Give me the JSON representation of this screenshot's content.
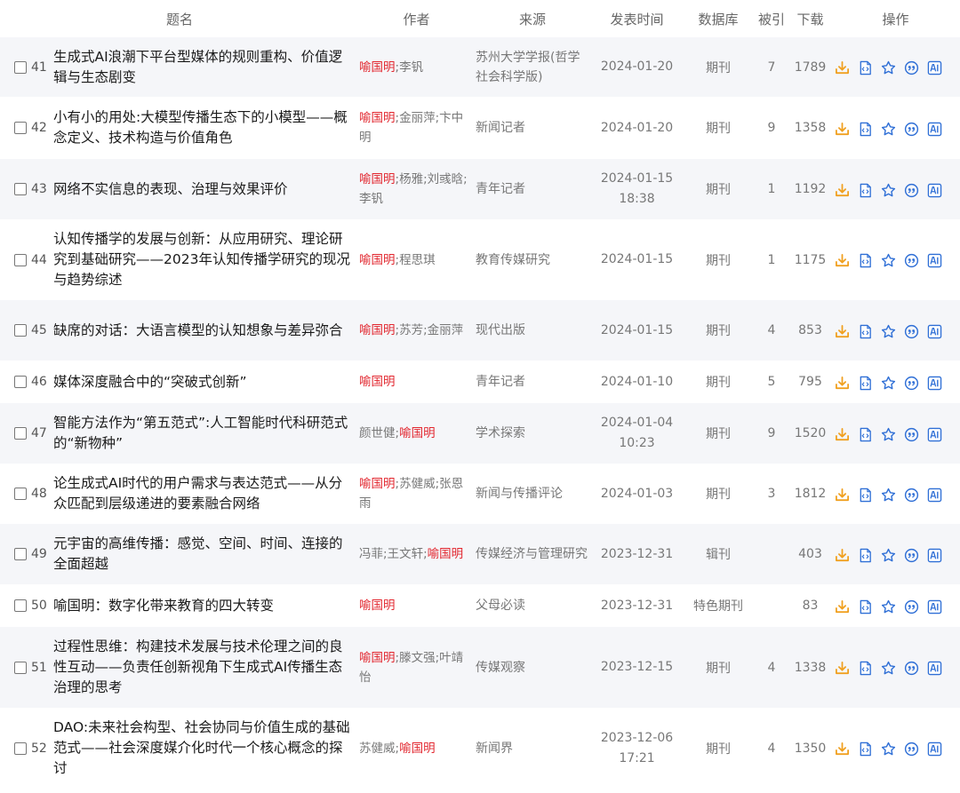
{
  "headers": {
    "title": "题名",
    "author": "作者",
    "source": "来源",
    "date": "发表时间",
    "db": "数据库",
    "cited": "被引",
    "downloads": "下载",
    "ops": "操作"
  },
  "colors": {
    "accent": "#e2262e",
    "download_icon": "#f0a020",
    "icon_blue": "#2f6fd6"
  },
  "operations": [
    "download-icon",
    "html-read-icon",
    "favorite-star-icon",
    "cite-quote-icon",
    "ai-assistant-icon"
  ],
  "rows": [
    {
      "num": "41",
      "title": "生成式AI浪潮下平台型媒体的规则重构、价值逻辑与生态剧变",
      "authors": [
        {
          "name": "喻国明",
          "hl": true
        },
        {
          "name": "李钒",
          "hl": false
        }
      ],
      "source": "苏州大学学报(哲学社会科学版)",
      "date": "2024-01-20",
      "time": "",
      "db": "期刊",
      "cited": "7",
      "downloads": "1789"
    },
    {
      "num": "42",
      "title": "小有小的用处:大模型传播生态下的小模型——概念定义、技术构造与价值角色",
      "authors": [
        {
          "name": "喻国明",
          "hl": true
        },
        {
          "name": "金丽萍",
          "hl": false
        },
        {
          "name": "卞中明",
          "hl": false
        }
      ],
      "source": "新闻记者",
      "date": "2024-01-20",
      "time": "",
      "db": "期刊",
      "cited": "9",
      "downloads": "1358"
    },
    {
      "num": "43",
      "title": "网络不实信息的表现、治理与效果评价",
      "authors": [
        {
          "name": "喻国明",
          "hl": true
        },
        {
          "name": "杨雅",
          "hl": false
        },
        {
          "name": "刘彧晗",
          "hl": false
        },
        {
          "name": "李钒",
          "hl": false
        }
      ],
      "source": "青年记者",
      "date": "2024-01-15",
      "time": "18:38",
      "db": "期刊",
      "cited": "1",
      "downloads": "1192"
    },
    {
      "num": "44",
      "title": "认知传播学的发展与创新：从应用研究、理论研究到基础研究——2023年认知传播学研究的现况与趋势综述",
      "authors": [
        {
          "name": "喻国明",
          "hl": true
        },
        {
          "name": "程思琪",
          "hl": false
        }
      ],
      "source": "教育传媒研究",
      "date": "2024-01-15",
      "time": "",
      "db": "期刊",
      "cited": "1",
      "downloads": "1175"
    },
    {
      "num": "45",
      "title": "缺席的对话：大语言模型的认知想象与差异弥合",
      "authors": [
        {
          "name": "喻国明",
          "hl": true
        },
        {
          "name": "苏芳",
          "hl": false
        },
        {
          "name": "金丽萍",
          "hl": false
        }
      ],
      "source": "现代出版",
      "date": "2024-01-15",
      "time": "",
      "db": "期刊",
      "cited": "4",
      "downloads": "853"
    },
    {
      "num": "46",
      "title": "媒体深度融合中的“突破式创新”",
      "authors": [
        {
          "name": "喻国明",
          "hl": true
        }
      ],
      "source": "青年记者",
      "date": "2024-01-10",
      "time": "",
      "db": "期刊",
      "cited": "5",
      "downloads": "795"
    },
    {
      "num": "47",
      "title": "智能方法作为“第五范式”:人工智能时代科研范式的“新物种”",
      "authors": [
        {
          "name": "颜世健",
          "hl": false
        },
        {
          "name": "喻国明",
          "hl": true
        }
      ],
      "source": "学术探索",
      "date": "2024-01-04",
      "time": "10:23",
      "db": "期刊",
      "cited": "9",
      "downloads": "1520"
    },
    {
      "num": "48",
      "title": "论生成式AI时代的用户需求与表达范式——从分众匹配到层级递进的要素融合网络",
      "authors": [
        {
          "name": "喻国明",
          "hl": true
        },
        {
          "name": "苏健威",
          "hl": false
        },
        {
          "name": "张恩雨",
          "hl": false
        }
      ],
      "source": "新闻与传播评论",
      "date": "2024-01-03",
      "time": "",
      "db": "期刊",
      "cited": "3",
      "downloads": "1812"
    },
    {
      "num": "49",
      "title": "元宇宙的高维传播：感觉、空间、时间、连接的全面超越",
      "authors": [
        {
          "name": "冯菲",
          "hl": false
        },
        {
          "name": "王文轩",
          "hl": false
        },
        {
          "name": "喻国明",
          "hl": true
        }
      ],
      "source": "传媒经济与管理研究",
      "date": "2023-12-31",
      "time": "",
      "db": "辑刊",
      "cited": "",
      "downloads": "403"
    },
    {
      "num": "50",
      "title": "喻国明：数字化带来教育的四大转变",
      "authors": [
        {
          "name": "喻国明",
          "hl": true
        }
      ],
      "source": "父母必读",
      "date": "2023-12-31",
      "time": "",
      "db": "特色期刊",
      "cited": "",
      "downloads": "83"
    },
    {
      "num": "51",
      "title": "过程性思维：构建技术发展与技术伦理之间的良性互动——负责任创新视角下生成式AI传播生态治理的思考",
      "authors": [
        {
          "name": "喻国明",
          "hl": true
        },
        {
          "name": "滕文强",
          "hl": false
        },
        {
          "name": "叶靖怡",
          "hl": false
        }
      ],
      "source": "传媒观察",
      "date": "2023-12-15",
      "time": "",
      "db": "期刊",
      "cited": "4",
      "downloads": "1338"
    },
    {
      "num": "52",
      "title": "DAO:未来社会构型、社会协同与价值生成的基础范式——社会深度媒介化时代一个核心概念的探讨",
      "authors": [
        {
          "name": "苏健威",
          "hl": false
        },
        {
          "name": "喻国明",
          "hl": true
        }
      ],
      "source": "新闻界",
      "date": "2023-12-06",
      "time": "17:21",
      "db": "期刊",
      "cited": "4",
      "downloads": "1350"
    }
  ]
}
